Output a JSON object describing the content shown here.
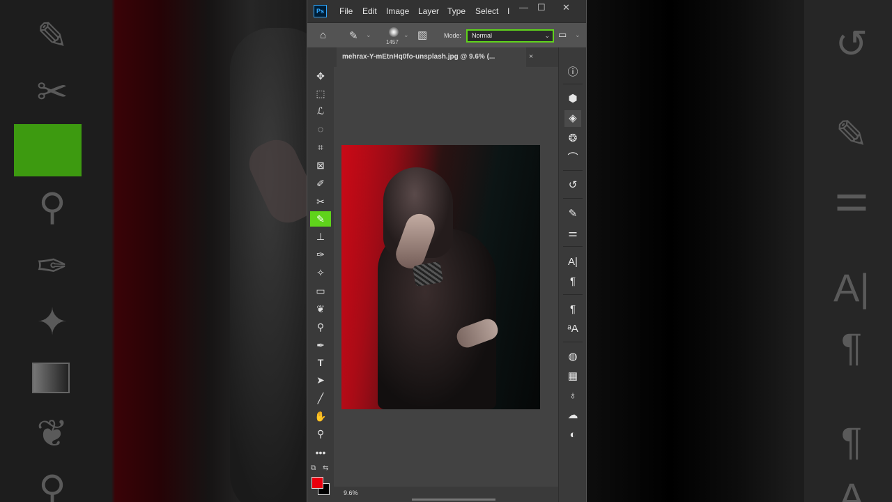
{
  "app": {
    "logo": "Ps"
  },
  "menu": [
    "File",
    "Edit",
    "Image",
    "Layer",
    "Type",
    "Select",
    "I"
  ],
  "window_controls": [
    "minimize-icon",
    "maximize-icon",
    "close-icon"
  ],
  "options_bar": {
    "brush_size": "1457",
    "mode_label": "Mode:",
    "mode_value": "Normal"
  },
  "document": {
    "tab_title": "mehrax-Y-mEtnHq0fo-unsplash.jpg @ 9.6% (...",
    "close_glyph": "×"
  },
  "status": {
    "zoom": "9.6%"
  },
  "tools": [
    "move-tool",
    "marquee-tool",
    "lasso-tool",
    "quick-selection-tool",
    "crop-tool",
    "frame-tool",
    "eyedropper-tool",
    "healing-brush-tool",
    "brush-tool",
    "clone-stamp-tool",
    "history-brush-tool",
    "eraser-tool",
    "gradient-tool",
    "blur-tool",
    "dodge-tool",
    "pen-tool",
    "type-tool",
    "path-selection-tool",
    "line-tool",
    "hand-tool",
    "zoom-tool",
    "more-tools"
  ],
  "active_tool": "brush-tool",
  "colors": {
    "foreground": "#e8000d",
    "background": "#000000",
    "accent": "#5fd31b",
    "ps_blue": "#31a8ff"
  },
  "right_panel_icons": [
    "info-icon",
    "3d-icon",
    "layers-icon",
    "channels-icon",
    "paths-icon",
    "history-icon",
    "brush-settings-icon",
    "adjustments-icon",
    "character-icon",
    "paragraph-icon",
    "paragraph-styles-icon",
    "character-styles-icon",
    "swatches-icon",
    "grid-icon",
    "learn-icon",
    "libraries-icon",
    "color-icon"
  ]
}
